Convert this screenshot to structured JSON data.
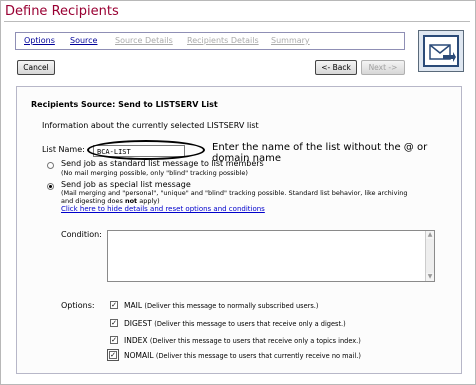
{
  "page": {
    "title": "Define Recipients"
  },
  "tabs": [
    {
      "label": "Options",
      "state": "active"
    },
    {
      "label": "Source",
      "state": "current"
    },
    {
      "label": "Source Details",
      "state": "disabled"
    },
    {
      "label": "Recipients Details",
      "state": "disabled"
    },
    {
      "label": "Summary",
      "state": "disabled"
    }
  ],
  "buttons": {
    "cancel": "Cancel",
    "back": "<- Back",
    "next": "Next ->"
  },
  "panel": {
    "heading": "Recipients Source: Send to LISTSERV List",
    "info": "Information about the currently selected LISTSERV list",
    "list_name_label": "List Name:",
    "list_name_value": "BCA-LIST",
    "callout": "Enter the name of the list without the @ or domain name",
    "radio_standard": {
      "title": "Send job as standard list message to list members",
      "subtitle": "(No mail merging possible, only \"blind\" tracking possible)"
    },
    "radio_special": {
      "title": "Send job as special list message",
      "subtitle_line1": "(Mail merging and \"personal\", \"unique\" and \"blind\" tracking possible. Standard list behavior, like archiving",
      "subtitle_line2_a": "and digesting does ",
      "subtitle_line2_b": "not",
      "subtitle_line2_c": " apply)"
    },
    "hide_link": "Click here to hide details and reset options and conditions",
    "condition_label": "Condition:",
    "condition_value": "",
    "options_label": "Options:",
    "options": [
      {
        "name": "MAIL",
        "desc": "(Deliver this message to normally subscribed users.)",
        "checked": true
      },
      {
        "name": "DIGEST",
        "desc": "(Deliver this message to users that receive only a digest.)",
        "checked": true
      },
      {
        "name": "INDEX",
        "desc": "(Deliver this message to users that receive only a topics index.)",
        "checked": true
      },
      {
        "name": "NOMAIL",
        "desc": "(Deliver this message to users that currently receive no mail.)",
        "checked": true
      }
    ]
  },
  "colors": {
    "title": "#990033",
    "link": "#0000cc",
    "tab_active": "#000099",
    "tab_disabled": "#aaaaaa"
  }
}
